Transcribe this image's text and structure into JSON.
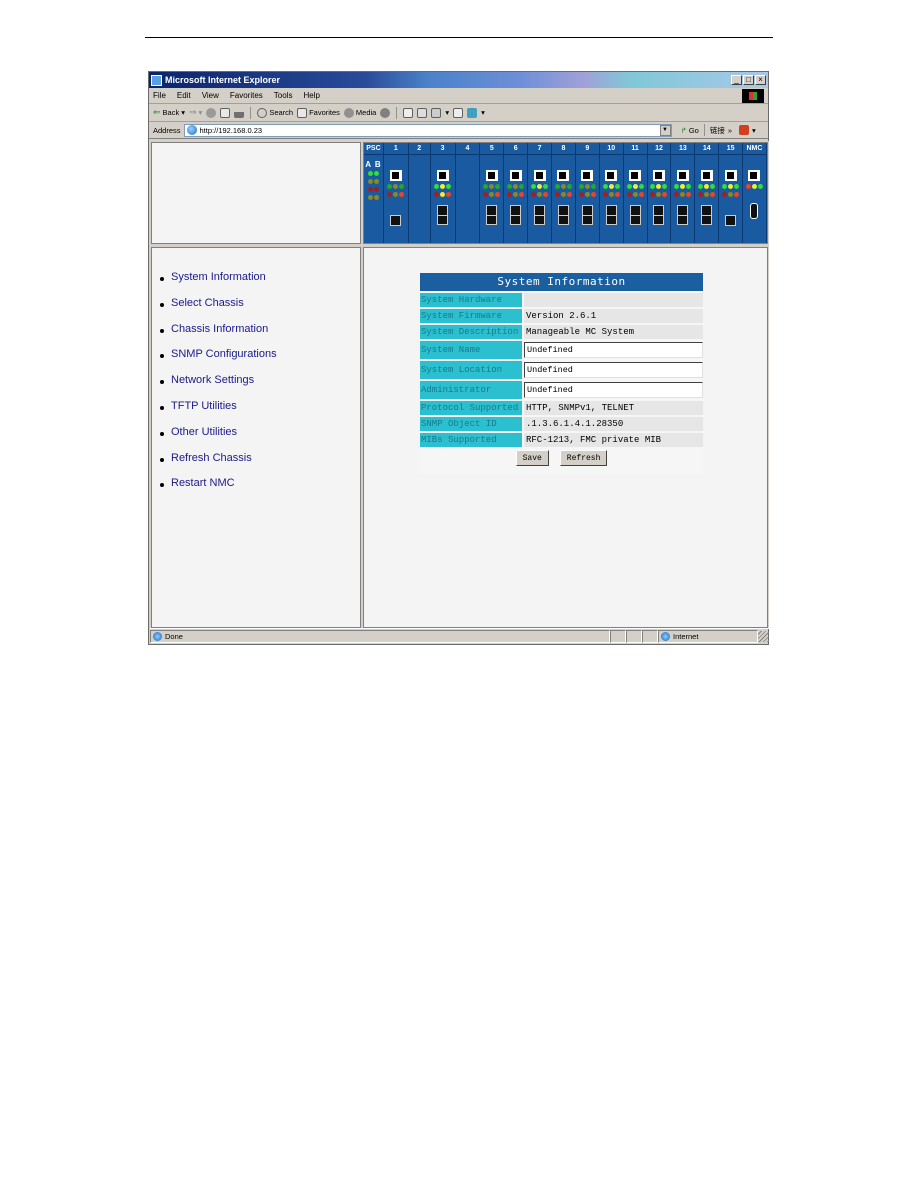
{
  "window": {
    "title": "Microsoft Internet Explorer",
    "controls": [
      "_",
      "□",
      "×"
    ]
  },
  "menubar": {
    "items": [
      {
        "label": "File",
        "accel": "F"
      },
      {
        "label": "Edit",
        "accel": "E"
      },
      {
        "label": "View",
        "accel": "V"
      },
      {
        "label": "Favorites",
        "accel": "a"
      },
      {
        "label": "Tools",
        "accel": "T"
      },
      {
        "label": "Help",
        "accel": "H"
      }
    ]
  },
  "toolbar": {
    "back_label": "Back",
    "search_label": "Search",
    "favorites_label": "Favorites",
    "media_label": "Media"
  },
  "addressbar": {
    "label": "Address",
    "url": "http://192.168.0.23",
    "go_label": "Go",
    "links_label": "链接",
    "links_chevron": "»"
  },
  "chassis": {
    "slots": [
      {
        "label": "PSC",
        "type": "psc",
        "sub": "A B",
        "leds": [
          [
            "#33dd33",
            "#33dd33"
          ],
          [
            "#8a8a20",
            "#8a8a20"
          ],
          [
            "#a02020",
            "#a02020"
          ],
          [
            "#8a8a20",
            "#8a8a20"
          ]
        ]
      },
      {
        "label": "1",
        "type": "card",
        "port": "single",
        "leds": [
          [
            "#22aa22",
            "#8a8a20",
            "#22aa22"
          ],
          [
            "#a02020",
            "#8a8a20",
            "#ee4422"
          ]
        ]
      },
      {
        "label": "2",
        "type": "empty"
      },
      {
        "label": "3",
        "type": "card",
        "port": "dual",
        "leds": [
          [
            "#33dd33",
            "#eeee33",
            "#33dd33"
          ],
          [
            "#a02020",
            "#eeee33",
            "#ee4422"
          ]
        ]
      },
      {
        "label": "4",
        "type": "empty"
      },
      {
        "label": "5",
        "type": "card",
        "port": "dual",
        "leds": [
          [
            "#22aa22",
            "#8a8a20",
            "#22aa22"
          ],
          [
            "#a02020",
            "#8a8a20",
            "#ee4422"
          ]
        ]
      },
      {
        "label": "6",
        "type": "card",
        "port": "dual",
        "leds": [
          [
            "#22aa22",
            "#8a8a20",
            "#22aa22"
          ],
          [
            "#a02020",
            "#8a8a20",
            "#ee4422"
          ]
        ]
      },
      {
        "label": "7",
        "type": "card",
        "port": "dual",
        "leds": [
          [
            "#33dd33",
            "#eeee33",
            "#33dd33"
          ],
          [
            "#a02020",
            "#8a8a20",
            "#ee4422"
          ]
        ]
      },
      {
        "label": "8",
        "type": "card",
        "port": "dual",
        "leds": [
          [
            "#22aa22",
            "#8a8a20",
            "#22aa22"
          ],
          [
            "#a02020",
            "#8a8a20",
            "#ee4422"
          ]
        ]
      },
      {
        "label": "9",
        "type": "card",
        "port": "dual",
        "leds": [
          [
            "#22aa22",
            "#8a8a20",
            "#22aa22"
          ],
          [
            "#a02020",
            "#8a8a20",
            "#ee4422"
          ]
        ]
      },
      {
        "label": "10",
        "type": "card",
        "port": "dual",
        "leds": [
          [
            "#33dd33",
            "#eeee33",
            "#33dd33"
          ],
          [
            "#a02020",
            "#8a8a20",
            "#ee4422"
          ]
        ]
      },
      {
        "label": "11",
        "type": "card",
        "port": "dual",
        "leds": [
          [
            "#33dd33",
            "#eeee33",
            "#33dd33"
          ],
          [
            "#a02020",
            "#8a8a20",
            "#ee4422"
          ]
        ]
      },
      {
        "label": "12",
        "type": "card",
        "port": "dual",
        "leds": [
          [
            "#33dd33",
            "#eeee33",
            "#33dd33"
          ],
          [
            "#a02020",
            "#8a8a20",
            "#ee4422"
          ]
        ]
      },
      {
        "label": "13",
        "type": "card",
        "port": "dual",
        "leds": [
          [
            "#33dd33",
            "#eeee33",
            "#33dd33"
          ],
          [
            "#a02020",
            "#8a8a20",
            "#ee4422"
          ]
        ]
      },
      {
        "label": "14",
        "type": "card",
        "port": "dual",
        "leds": [
          [
            "#33dd33",
            "#eeee33",
            "#33dd33"
          ],
          [
            "#a02020",
            "#8a8a20",
            "#ee4422"
          ]
        ]
      },
      {
        "label": "15",
        "type": "card",
        "port": "single",
        "leds": [
          [
            "#33dd33",
            "#eeee33",
            "#33dd33"
          ],
          [
            "#a02020",
            "#8a8a20",
            "#ee4422"
          ]
        ]
      },
      {
        "label": "NMC",
        "type": "nmc",
        "leds": [
          [
            "#ee4422",
            "#eeee33",
            "#33dd33"
          ]
        ]
      }
    ]
  },
  "nav": {
    "items": [
      "System Information",
      "Select Chassis",
      "Chassis Information",
      "SNMP Configurations",
      "Network Settings",
      "TFTP Utilities",
      "Other Utilities",
      "Refresh Chassis",
      "Restart NMC"
    ]
  },
  "sysinfo": {
    "title": "System Information",
    "rows": [
      {
        "label": "System Hardware",
        "value": "",
        "editable": false
      },
      {
        "label": "System Firmware",
        "value": "Version 2.6.1",
        "editable": false
      },
      {
        "label": "System Description",
        "value": "Manageable MC System",
        "editable": false
      },
      {
        "label": "System Name",
        "value": "Undefined",
        "editable": true
      },
      {
        "label": "System Location",
        "value": "Undefined",
        "editable": true
      },
      {
        "label": "Administrator",
        "value": "Undefined",
        "editable": true
      },
      {
        "label": "Protocol Supported",
        "value": "HTTP, SNMPv1, TELNET",
        "editable": false
      },
      {
        "label": "SNMP Object ID",
        "value": ".1.3.6.1.4.1.28350",
        "editable": false
      },
      {
        "label": "MIBs Supported",
        "value": "RFC-1213, FMC private MIB",
        "editable": false
      }
    ],
    "save_label": "Save",
    "refresh_label": "Refresh"
  },
  "statusbar": {
    "status": "Done",
    "zone": "Internet"
  }
}
